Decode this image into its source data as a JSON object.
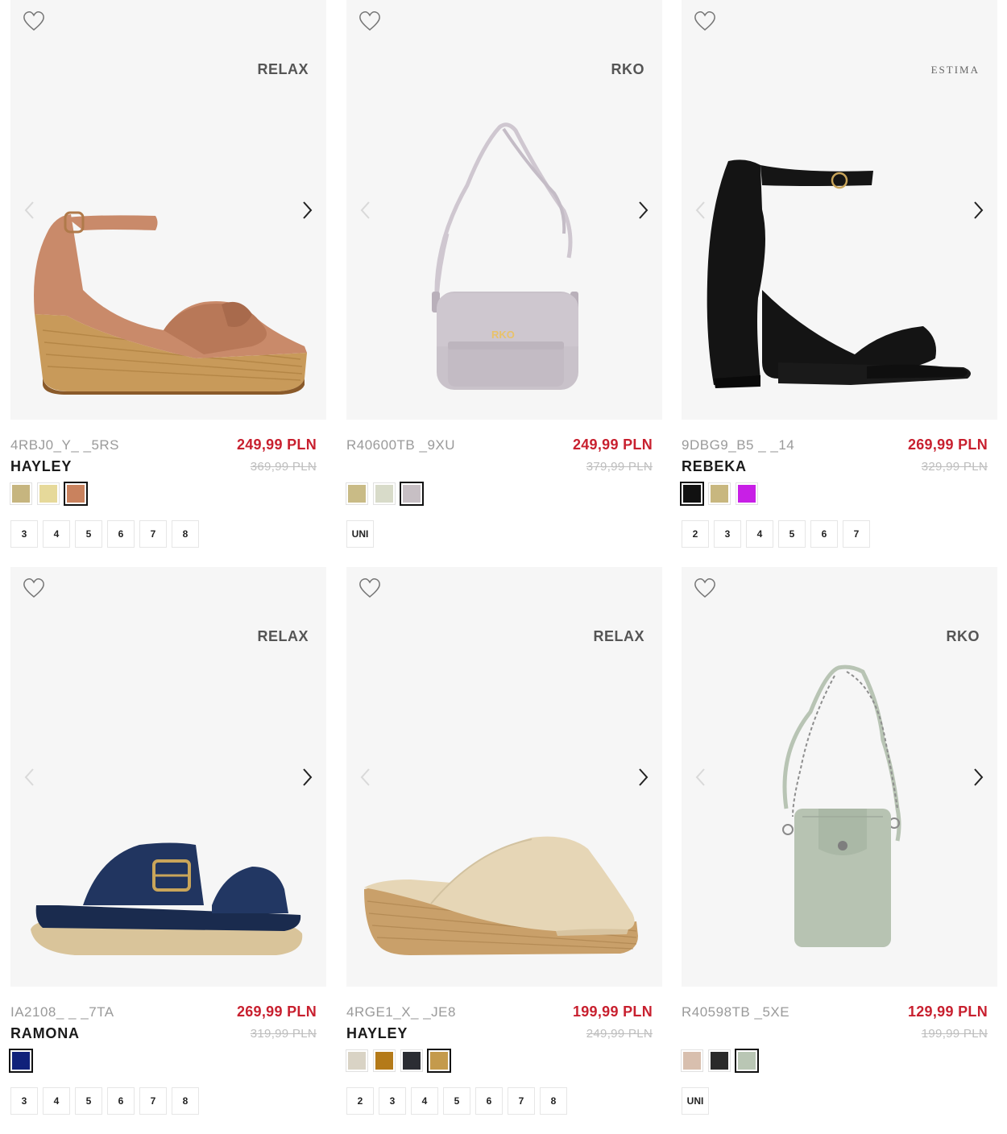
{
  "products": [
    {
      "brand": "RELAX",
      "code": "4RBJ0_Y_ _5RS",
      "name": "HAYLEY",
      "price": "249,99 PLN",
      "old_price": "369,99 PLN",
      "swatches": [
        "#c6b57f",
        "#e6d99a",
        "#c9825e"
      ],
      "active_swatch": 2,
      "sizes": [
        "3",
        "4",
        "5",
        "6",
        "7",
        "8"
      ]
    },
    {
      "brand": "RKO",
      "code": "R40600TB _9XU",
      "name": "",
      "price": "249,99 PLN",
      "old_price": "379,99 PLN",
      "swatches": [
        "#c9bb86",
        "#d8dbc9",
        "#c7bfc4"
      ],
      "active_swatch": 2,
      "sizes": [
        "UNI"
      ]
    },
    {
      "brand": "ESTIMA",
      "code": "9DBG9_B5 _ _14",
      "name": "REBEKA",
      "price": "269,99 PLN",
      "old_price": "329,99 PLN",
      "swatches": [
        "#111111",
        "#c8b77f",
        "#c81fe6"
      ],
      "active_swatch": 0,
      "sizes": [
        "2",
        "3",
        "4",
        "5",
        "6",
        "7"
      ]
    },
    {
      "brand": "RELAX",
      "code": "IA2108_ _ _7TA",
      "name": "RAMONA",
      "price": "269,99 PLN",
      "old_price": "319,99 PLN",
      "swatches": [
        "#10217a"
      ],
      "active_swatch": 0,
      "sizes": [
        "3",
        "4",
        "5",
        "6",
        "7",
        "8"
      ]
    },
    {
      "brand": "RELAX",
      "code": "4RGE1_X_ _JE8",
      "name": "HAYLEY",
      "price": "199,99 PLN",
      "old_price": "249,99 PLN",
      "swatches": [
        "#d9d3c5",
        "#b47a19",
        "#2b2d33",
        "#c49a4c"
      ],
      "active_swatch": 3,
      "sizes": [
        "2",
        "3",
        "4",
        "5",
        "6",
        "7",
        "8"
      ]
    },
    {
      "brand": "RKO",
      "code": "R40598TB _5XE",
      "name": "",
      "price": "129,99 PLN",
      "old_price": "199,99 PLN",
      "swatches": [
        "#d8bfae",
        "#2a2a2a",
        "#b9c6b4"
      ],
      "active_swatch": 2,
      "sizes": [
        "UNI"
      ]
    }
  ],
  "icons": {
    "favorite": "heart-outline-icon",
    "prev": "chevron-left-icon",
    "next": "chevron-right-icon"
  },
  "colors": {
    "price_red": "#c8202f",
    "image_bg": "#f6f6f6"
  }
}
